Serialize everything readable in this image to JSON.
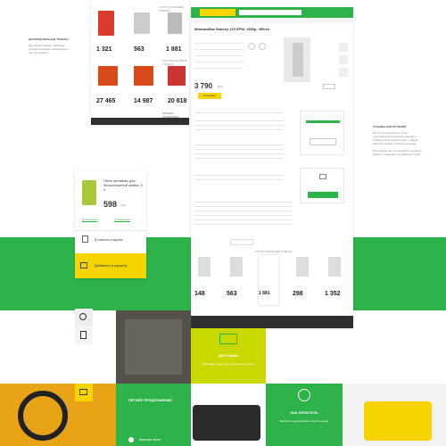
{
  "left_panel": {
    "title": "ДОПОЛНИТЕЛЬНЫЕ ТОВАРЫ",
    "desc": "Эти блоки создают наиболее полный перечень необходимого для покупателя."
  },
  "right_panel": {
    "title": "ОТЗЫВЫ ПОКУПАТЕЛЕЙ",
    "desc1": "Этот блок появляется, если пользователю интересно мнение о товаре других покупателей – общий рейтинг поможет принять решение",
    "desc2": "При появлении он становится на место блока с товарами, опускаясь его ниже"
  },
  "mini_site": {
    "section": "СОПУТСТВУЮЩИЕ ТОВАРЫ",
    "recommended": "РЕКОМЕНДУЕМЫЕ ТОВАРЫ",
    "catalog": "КАТАЛОГ ПРОДУКЦИИ",
    "prices": [
      "1 321",
      "563",
      "1 881",
      "27 465",
      "14 987",
      "20 818"
    ],
    "rub": "руб."
  },
  "product": {
    "title": "Минимойка Stanley 120 EPW, 1350р, 450л/ч",
    "price": "3 790",
    "rub": "руб.",
    "buy": "В корзину"
  },
  "popup": {
    "title": "Пена активная для бесконтактной мойки. 5 л",
    "price": "598",
    "rub": "руб.",
    "in_store": "В магазинах",
    "compare": "К сравнению",
    "wishlist": "В список покупок",
    "add_cart": "Добавить в корзину"
  },
  "bottom_row": {
    "section": "СОПУТСТВУЮЩИЕ ТОВАРЫ",
    "prices": [
      "148",
      "563",
      "1 881",
      "298",
      "1 352"
    ],
    "rub": "руб."
  },
  "tiles": {
    "delivery_title": "ДОСТАВКА",
    "delivery_desc": "Доставка товаров до двери вашего дома",
    "summer_title": "ЛЕТНЕЕ ПРЕДЛОЖЕНИЕ",
    "catalog_link": "Каталог всех",
    "pay_title": "КАК ОПЛАТИТЬ",
    "pay_desc": "Выберите удобный вам способ оплаты"
  },
  "colors": {
    "green": "#2db34a",
    "yellow": "#f5d400",
    "dark": "#2f2f2f"
  }
}
